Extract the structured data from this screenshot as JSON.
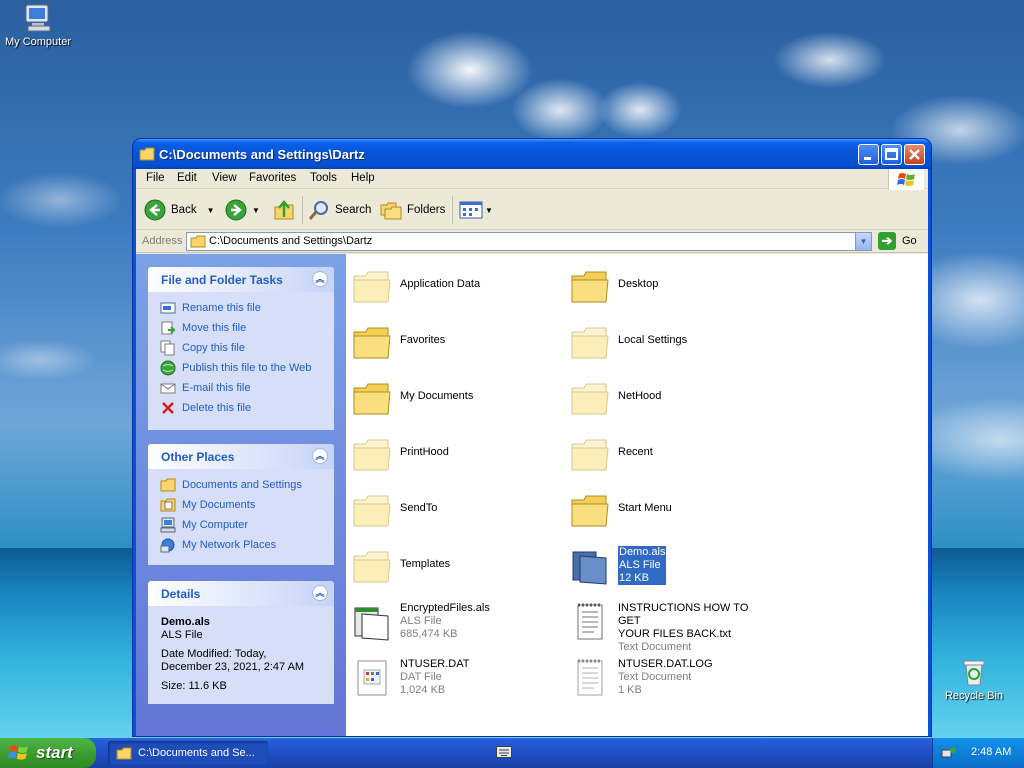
{
  "desktop": {
    "icons": [
      {
        "label": "My Computer"
      },
      {
        "label": "Recycle Bin"
      }
    ]
  },
  "window": {
    "title": "C:\\Documents and Settings\\Dartz",
    "menu": [
      "File",
      "Edit",
      "View",
      "Favorites",
      "Tools",
      "Help"
    ],
    "toolbar": {
      "back": "Back",
      "search": "Search",
      "folders": "Folders"
    },
    "address": {
      "label": "Address",
      "value": "C:\\Documents and Settings\\Dartz",
      "go": "Go"
    }
  },
  "leftpane": {
    "file_tasks": {
      "title": "File and Folder Tasks",
      "items": [
        {
          "label": "Rename this file",
          "icon": "rename-icon"
        },
        {
          "label": "Move this file",
          "icon": "move-icon"
        },
        {
          "label": "Copy this file",
          "icon": "copy-icon"
        },
        {
          "label": "Publish this file to the Web",
          "icon": "globe-icon"
        },
        {
          "label": "E-mail this file",
          "icon": "email-icon"
        },
        {
          "label": "Delete this file",
          "icon": "delete-icon"
        }
      ]
    },
    "other_places": {
      "title": "Other Places",
      "items": [
        {
          "label": "Documents and Settings",
          "icon": "folder-icon"
        },
        {
          "label": "My Documents",
          "icon": "my-documents-icon"
        },
        {
          "label": "My Computer",
          "icon": "computer-icon"
        },
        {
          "label": "My Network Places",
          "icon": "network-icon"
        }
      ]
    },
    "details": {
      "title": "Details",
      "name": "Demo.als",
      "type": "ALS File",
      "modified_label": "Date Modified: Today,",
      "modified_value": "December 23, 2021, 2:47 AM",
      "size": "Size: 11.6 KB"
    }
  },
  "files": [
    {
      "name": "Application Data",
      "kind": "folder-pale"
    },
    {
      "name": "Desktop",
      "kind": "folder"
    },
    {
      "name": "Favorites",
      "kind": "folder"
    },
    {
      "name": "Local Settings",
      "kind": "folder-pale"
    },
    {
      "name": "My Documents",
      "kind": "folder"
    },
    {
      "name": "NetHood",
      "kind": "folder-pale"
    },
    {
      "name": "PrintHood",
      "kind": "folder-pale"
    },
    {
      "name": "Recent",
      "kind": "folder-pale"
    },
    {
      "name": "SendTo",
      "kind": "folder-pale"
    },
    {
      "name": "Start Menu",
      "kind": "folder"
    },
    {
      "name": "Templates",
      "kind": "folder-pale"
    },
    {
      "name": "Demo.als",
      "type": "ALS File",
      "size": "12 KB",
      "kind": "als",
      "selected": true
    },
    {
      "name": "EncryptedFiles.als",
      "type": "ALS File",
      "size": "685,474 KB",
      "kind": "als"
    },
    {
      "name_line1": "INSTRUCTIONS HOW TO GET",
      "name_line2": "YOUR FILES BACK.txt",
      "type": "Text Document",
      "kind": "txt"
    },
    {
      "name": "NTUSER.DAT",
      "type": "DAT File",
      "size": "1,024 KB",
      "kind": "dat"
    },
    {
      "name": "NTUSER.DAT.LOG",
      "type": "Text Document",
      "size": "1 KB",
      "kind": "txt"
    }
  ],
  "taskbar": {
    "start": "start",
    "task_button": "C:\\Documents and Se...",
    "clock": "2:48 AM"
  },
  "colors": {
    "title_blue": "#0a5fe8",
    "link_blue": "#215dc6",
    "selection": "#316ac5",
    "start_green": "#3c9e2f"
  }
}
